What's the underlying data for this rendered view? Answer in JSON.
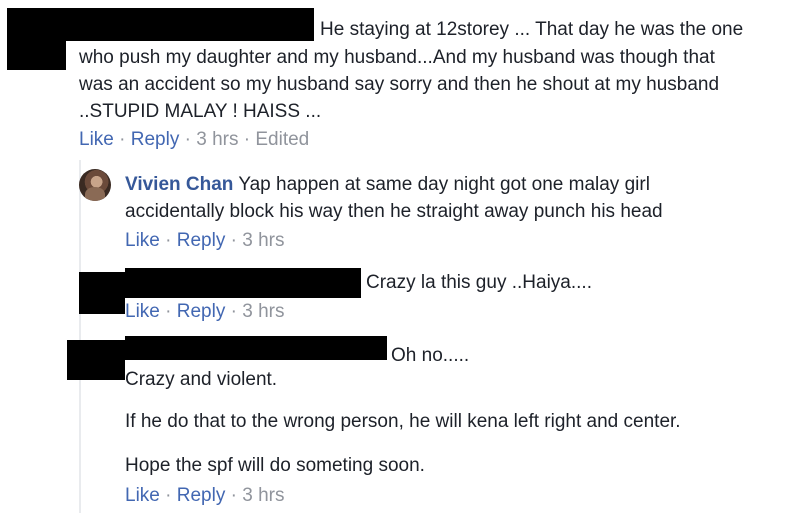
{
  "comment1": {
    "lines": [
      "He staying at 12storey ... That day he was the one",
      "who push my daughter and my husband...And my husband was though that",
      "was an accident so my husband say sorry and then he shout at my husband",
      "..STUPID MALAY ! HAISS ..."
    ],
    "actions": {
      "like": "Like",
      "sep": "·",
      "reply": "Reply",
      "time": "3 hrs",
      "edited": "Edited"
    }
  },
  "reply1": {
    "author": "Vivien Chan",
    "line1": "Yap happen at same day night got one malay girl",
    "line2": "accidentally block his way then he straight away punch his head",
    "actions": {
      "like": "Like",
      "sep": "·",
      "reply": "Reply",
      "time": "3 hrs"
    }
  },
  "reply2": {
    "text": "Crazy la this guy ..Haiya....",
    "actions": {
      "like": "Like",
      "sep": "·",
      "reply": "Reply",
      "time": "3 hrs"
    }
  },
  "reply3": {
    "line1": "Oh no.....",
    "line2": "Crazy and violent.",
    "line3": "If he do that to the wrong person, he will kena left right and center.",
    "line4": "Hope the spf will do someting soon.",
    "actions": {
      "like": "Like",
      "sep": "·",
      "reply": "Reply",
      "time": "3 hrs"
    }
  }
}
